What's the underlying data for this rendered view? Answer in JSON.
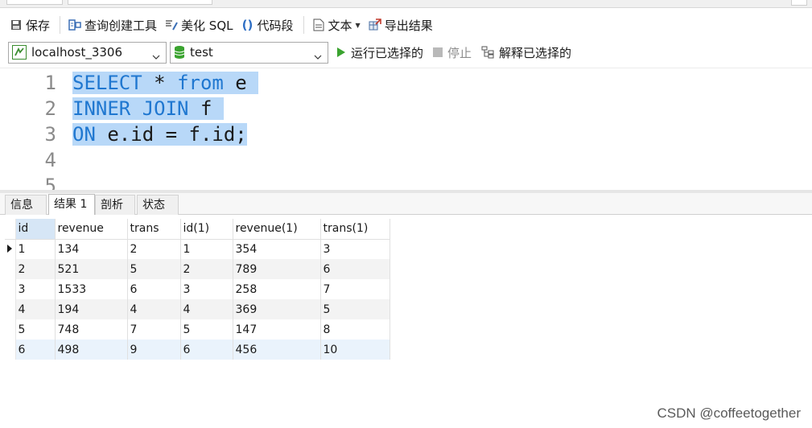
{
  "toolbar": {
    "save": {
      "label": "保存",
      "icon": "save-icon"
    },
    "query_builder": {
      "label": "查询创建工具",
      "icon": "query-builder-icon"
    },
    "beautify": {
      "label": "美化 SQL",
      "icon": "beautify-sql-icon"
    },
    "snippet": {
      "label": "代码段",
      "icon": "code-snippet-icon"
    },
    "text": {
      "label": "文本",
      "icon": "text-doc-icon"
    },
    "export": {
      "label": "导出结果",
      "icon": "export-results-icon"
    }
  },
  "connection": {
    "server": "localhost_3306",
    "database": "test",
    "run_selected": "运行已选择的",
    "stop": "停止",
    "explain_selected": "解释已选择的"
  },
  "editor": {
    "lines": [
      {
        "num": "1",
        "tokens": [
          {
            "t": "SELECT",
            "kw": true
          },
          {
            "t": " * ",
            "kw": false
          },
          {
            "t": "from",
            "kw": true
          },
          {
            "t": " e ",
            "kw": false
          }
        ]
      },
      {
        "num": "2",
        "tokens": [
          {
            "t": "INNER JOIN",
            "kw": true
          },
          {
            "t": " f ",
            "kw": false
          }
        ]
      },
      {
        "num": "3",
        "tokens": [
          {
            "t": "ON",
            "kw": true
          },
          {
            "t": " e.id = f.id;",
            "kw": false
          }
        ]
      },
      {
        "num": "4",
        "tokens": []
      },
      {
        "num": "5",
        "tokens": []
      }
    ]
  },
  "result_tabs": [
    {
      "label": "信息",
      "active": false
    },
    {
      "label": "结果 1",
      "active": true
    },
    {
      "label": "剖析",
      "active": false
    },
    {
      "label": "状态",
      "active": false
    }
  ],
  "grid": {
    "columns": [
      "id",
      "revenue",
      "trans",
      "id(1)",
      "revenue(1)",
      "trans(1)"
    ],
    "rows": [
      [
        "1",
        "134",
        "2",
        "1",
        "354",
        "3"
      ],
      [
        "2",
        "521",
        "5",
        "2",
        "789",
        "6"
      ],
      [
        "3",
        "1533",
        "6",
        "3",
        "258",
        "7"
      ],
      [
        "4",
        "194",
        "4",
        "4",
        "369",
        "5"
      ],
      [
        "5",
        "748",
        "7",
        "5",
        "147",
        "8"
      ],
      [
        "6",
        "498",
        "9",
        "6",
        "456",
        "10"
      ]
    ]
  },
  "watermark": "CSDN @coffeetogether",
  "colors": {
    "keyword": "#1f77d0",
    "selection": "#b8d8f8",
    "run_green": "#3aa32f"
  }
}
